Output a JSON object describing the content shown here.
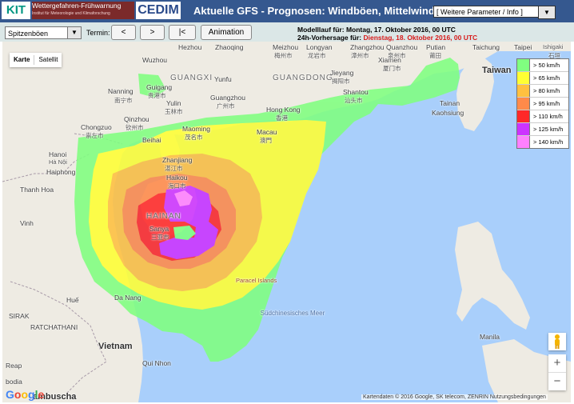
{
  "header": {
    "kit_logo": "KIT",
    "warn_logo": "Wettergefahren-Frühwarnung",
    "warn_logo_sub": "Institut für Meteorologie und Klimaforschung",
    "cedim_logo": "CEDIM",
    "title": "Aktuelle GFS - Prognosen: Windböen, Mittelwind",
    "param_select": "[ Weitere Parameter / Info ]"
  },
  "controls": {
    "variable_select": "Spitzenböen",
    "termin_label": "Termin:",
    "prev_button": "<",
    "next_button": ">",
    "first_button": "|<",
    "animation_button": "Animation",
    "modelllauf_label": "Modelllauf für:",
    "modelllauf_value": "Montag, 17. Oktober 2016, 00 UTC",
    "forecast_label": "24h-Vorhersage für:",
    "forecast_value": "Dienstag, 18. Oktober 2016, 00 UTC"
  },
  "map": {
    "map_type": [
      "Karte",
      "Satellit"
    ],
    "selected_map_type": "Karte",
    "legend": [
      {
        "label": "> 50 km/h",
        "color": "#80ff80"
      },
      {
        "label": "> 65 km/h",
        "color": "#ffff33"
      },
      {
        "label": "> 80 km/h",
        "color": "#ffc040"
      },
      {
        "label": "> 95 km/h",
        "color": "#ff8a4a"
      },
      {
        "label": "> 110 km/h",
        "color": "#ff2828"
      },
      {
        "label": "> 125 km/h",
        "color": "#cc33ff"
      },
      {
        "label": "> 140 km/h",
        "color": "#ff80ff"
      }
    ],
    "labels": {
      "taiwan": "Taiwan",
      "vietnam": "Vietnam",
      "guangxi": "GUANGXI",
      "guangdong": "GUANGDONG",
      "hainan": "HAINAN",
      "hanoi": "Hanoi",
      "hanoi_native": "Hà Nội",
      "haiphong": "Haiphong",
      "thanh_hoa": "Thanh Hoa",
      "vinh": "Vinh",
      "da_nang": "Da Nang",
      "qui_nhon": "Qui Nhon",
      "nanning": "Nanning",
      "nanning_native": "南宁市",
      "guigang": "Guigang",
      "guigang_native": "贵港市",
      "yulin": "Yulin",
      "yulin_native": "玉林市",
      "guangzhou": "Guangzhou",
      "guangzhou_native": "广州市",
      "hong_kong": "Hong Kong",
      "hong_kong_native": "香港",
      "macau": "Macau",
      "macau_native": "澳門",
      "shantou": "Shantou",
      "shantou_native": "汕头市",
      "jieyang": "Jieyang",
      "jieyang_native": "揭阳市",
      "xiamen": "Xiamen",
      "xiamen_native": "厦门市",
      "zhangzhou": "Zhangzhou",
      "zhangzhou_native": "漳州市",
      "quanzhou": "Quanzhou",
      "quanzhou_native": "泉州市",
      "putian": "Putian",
      "putian_native": "莆田",
      "longyan": "Longyan",
      "longyan_native": "龙岩市",
      "meizhou": "Meizhou",
      "meizhou_native": "梅州市",
      "maoming": "Maoming",
      "maoming_native": "茂名市",
      "zhanjiang": "Zhanjiang",
      "zhanjiang_native": "湛江市",
      "haikou": "Haikou",
      "haikou_native": "海口市",
      "sanya": "Sanya",
      "sanya_native": "三亚市",
      "qinzhou": "Qinzhou",
      "qinzhou_native": "钦州市",
      "chongzuo": "Chongzuo",
      "chongzuo_native": "崇左市",
      "beihai": "Beihai",
      "yunfu": "Yunfu",
      "zhaoqing": "Zhaoqing",
      "hezhou": "Hezhou",
      "wuzhou": "Wuzhou",
      "taichung": "Taichung",
      "tainan": "Tainan",
      "kaohsiung": "Kaohsiung",
      "taipei": "Taipei",
      "ishigaki": "Ishigaki",
      "ishigaki_native": "石垣",
      "manila": "Manila",
      "paracel": "Paracel Islands",
      "south_china_sea": "Südchinesisches Meer",
      "laos_ratchathani": "RATCHATHANI",
      "laos_sirak": "SIRAK",
      "laos_hue": "Huế",
      "reap": "Reap",
      "bodia": "bodia",
      "ambuscha": "ambuscha"
    },
    "google_logo": "Google",
    "attribution": "Kartendaten © 2016 Google, SK telecom, ZENRIN   Nutzungsbedingungen"
  }
}
